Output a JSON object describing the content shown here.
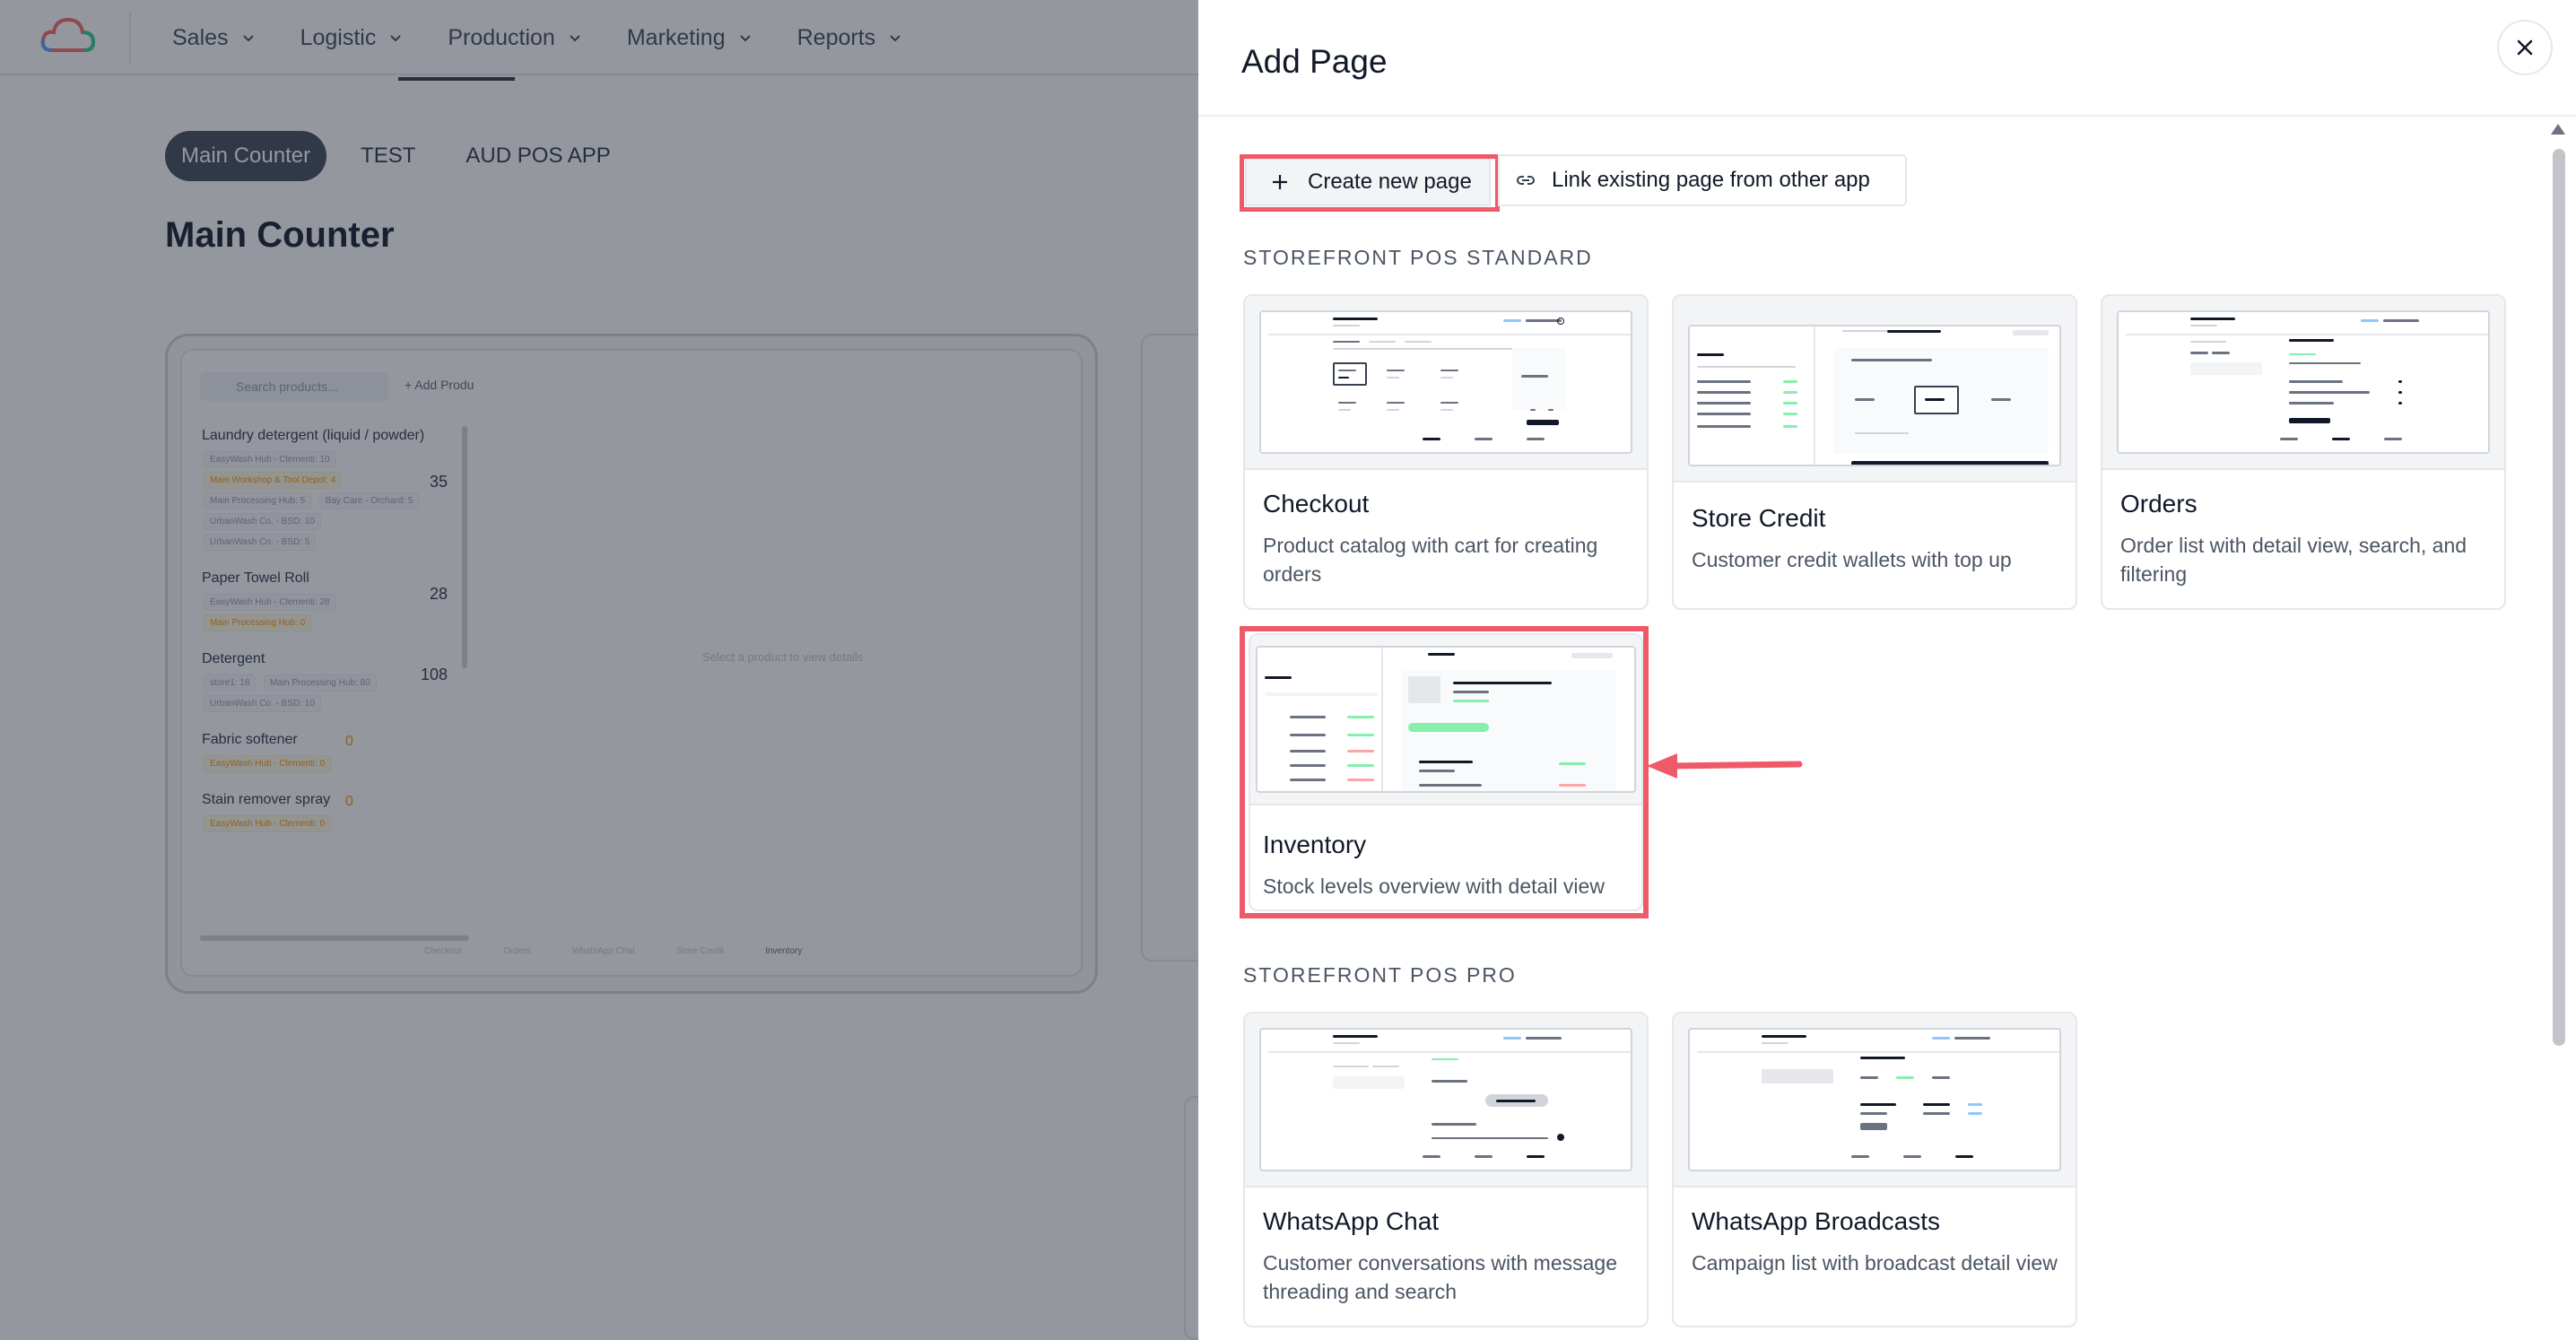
{
  "app": {
    "nav": [
      {
        "label": "Sales"
      },
      {
        "label": "Logistic"
      },
      {
        "label": "Production"
      },
      {
        "label": "Marketing"
      },
      {
        "label": "Reports"
      }
    ],
    "pills": [
      {
        "label": "Main Counter"
      },
      {
        "label": "TEST"
      },
      {
        "label": "AUD POS APP"
      }
    ],
    "page_title": "Main Counter",
    "preview": {
      "search_placeholder": "Search products...",
      "add_label": "Add Produ",
      "empty_state": "Select a product to view details",
      "items": [
        {
          "name": "Laundry detergent (liquid / powder)",
          "qty": "35",
          "chips": [
            "EasyWash Hub - Clementi: 10",
            "Main Workshop & Tool Depot: 4",
            "Main Processing Hub: 5",
            "Bay Care - Orchard: 5",
            "UrbanWash Co. - BSD: 10",
            "UrbanWash Co. - BSD: 5"
          ]
        },
        {
          "name": "Paper Towel Roll",
          "qty": "28",
          "chips": [
            "EasyWash Hub - Clementi: 28",
            "Main Processing Hub: 0"
          ]
        },
        {
          "name": "Detergent",
          "qty": "108",
          "chips": [
            "store1: 18",
            "Main Processing Hub: 80",
            "UrbanWash Co. - BSD: 10"
          ]
        },
        {
          "name": "Fabric softener",
          "qty": "0",
          "chips": [
            "EasyWash Hub - Clementi: 0"
          ]
        },
        {
          "name": "Stain remover spray",
          "qty": "0",
          "chips": [
            "EasyWash Hub - Clementi: 0"
          ]
        }
      ],
      "tabs": [
        {
          "label": "Checkout"
        },
        {
          "label": "Orders"
        },
        {
          "label": "WhatsApp Chat"
        },
        {
          "label": "Store Credit"
        },
        {
          "label": "Inventory"
        }
      ]
    }
  },
  "drawer": {
    "title": "Add Page",
    "create_label": "Create new page",
    "link_label": "Link existing page from other app",
    "sections": [
      {
        "label": "STOREFRONT POS STANDARD",
        "cards": [
          {
            "title": "Checkout",
            "desc": "Product catalog with cart for creating orders"
          },
          {
            "title": "Store Credit",
            "desc": "Customer credit wallets with top up"
          },
          {
            "title": "Orders",
            "desc": "Order list with detail view, search, and filtering"
          },
          {
            "title": "Inventory",
            "desc": "Stock levels overview with detail view"
          }
        ]
      },
      {
        "label": "STOREFRONT POS PRO",
        "cards": [
          {
            "title": "WhatsApp Chat",
            "desc": "Customer conversations with message threading and search"
          },
          {
            "title": "WhatsApp Broadcasts",
            "desc": "Campaign list with broadcast detail view"
          }
        ]
      }
    ]
  },
  "colors": {
    "highlight": "#ef5a68",
    "overlay": "#111827",
    "active_pill": "#4b5563"
  }
}
